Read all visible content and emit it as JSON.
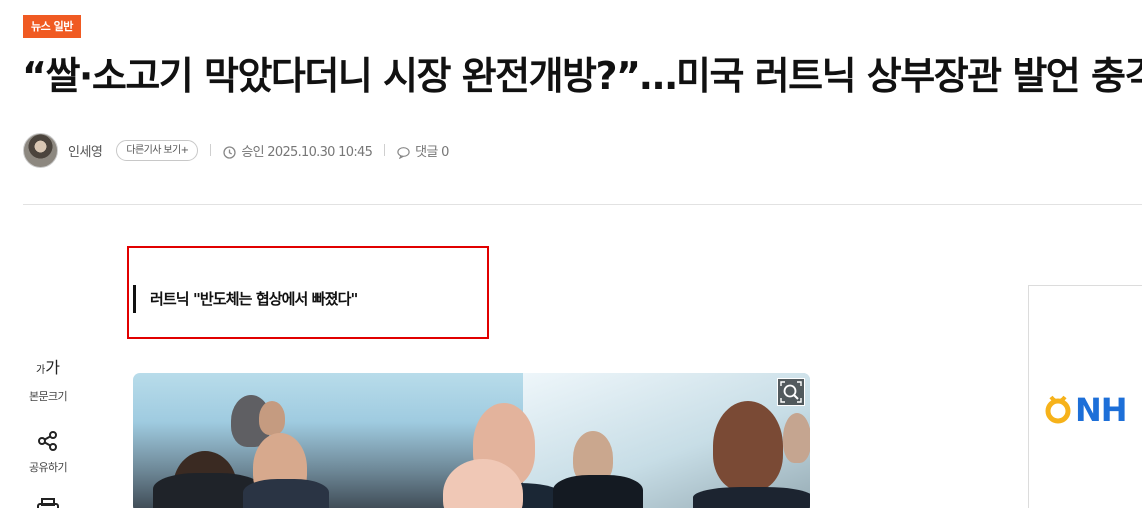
{
  "article": {
    "category": "뉴스 일반",
    "headline": "“쌀·소고기 막았다더니 시장 완전개방?”…미국 러트닉 상부장관 발언 충격",
    "author": "인세영",
    "more_articles_label": "다른기사 보기+",
    "published_label": "승인 2025.10.30 10:45",
    "comments_label": "댓글 0",
    "subheadline": "러트닉 \"반도체는 협상에서 빠졌다\""
  },
  "side_tools": {
    "font_size_glyph_small": "가",
    "font_size_glyph_large": "가",
    "font_size_label": "본문크기",
    "share_label": "공유하기"
  },
  "ad": {
    "logo_text": "NH"
  },
  "colors": {
    "category_bg": "#f05a22",
    "highlight_border": "#e10000",
    "ad_brand_blue": "#1d6fd8",
    "ad_brand_yellow": "#f6b21a"
  },
  "icons": [
    "clock-icon",
    "comment-icon",
    "share-icon",
    "print-icon",
    "zoom-icon"
  ]
}
